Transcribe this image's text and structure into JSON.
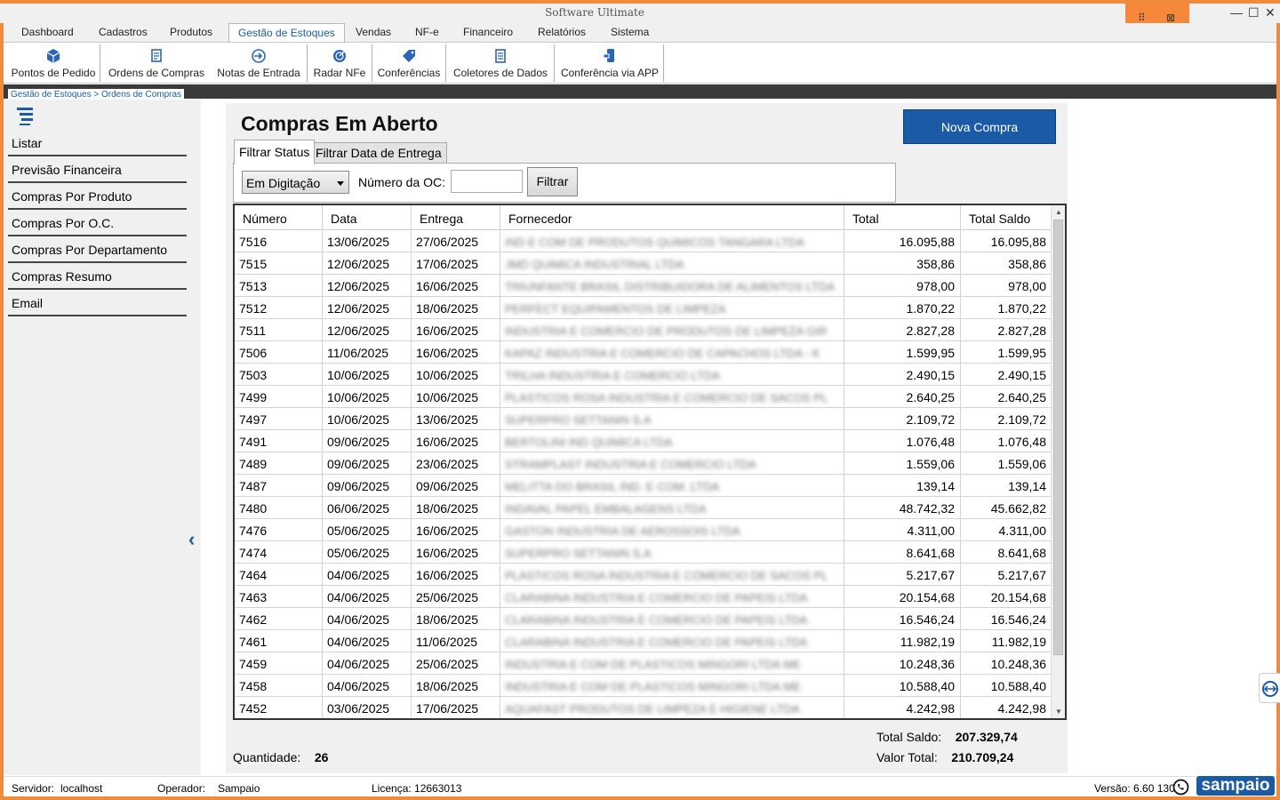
{
  "window": {
    "title": "Software Ultimate"
  },
  "menu": [
    "Dashboard",
    "Cadastros",
    "Produtos",
    "Gestão de Estoques",
    "Vendas",
    "NF-e",
    "Financeiro",
    "Relatórios",
    "Sistema"
  ],
  "toolbar": [
    "Pontos de Pedido",
    "Ordens de Compras",
    "Notas de Entrada",
    "Radar NFe",
    "Conferências",
    "Coletores de Dados",
    "Conferência via APP"
  ],
  "breadcrumb": "Gestão de Estoques > Ordens de Compras",
  "sidebar": [
    "Listar",
    "Previsão Financeira",
    "Compras Por Produto",
    "Compras Por O.C.",
    "Compras Por Departamento",
    "Compras Resumo",
    "Email"
  ],
  "page": {
    "title": "Compras Em Aberto",
    "new_button": "Nova Compra",
    "tabs": [
      "Filtrar Status",
      "Filtrar Data de Entrega"
    ],
    "status_select": "Em Digitação",
    "oc_label": "Número da OC:",
    "oc_value": "",
    "filter_button": "Filtrar"
  },
  "table": {
    "columns": [
      "Número",
      "Data",
      "Entrega",
      "Fornecedor",
      "Total",
      "Total Saldo"
    ],
    "rows": [
      [
        "7516",
        "13/06/2025",
        "27/06/2025",
        "IND E COM DE PRODUTOS QUIMICOS TANGARA LTDA",
        "16.095,88",
        "16.095,88"
      ],
      [
        "7515",
        "12/06/2025",
        "17/06/2025",
        "JMD QUIMICA INDUSTRIAL LTDA",
        "358,86",
        "358,86"
      ],
      [
        "7513",
        "12/06/2025",
        "16/06/2025",
        "TRIUNFANTE BRASIL DISTRIBUIDORA DE ALIMENTOS LTDA",
        "978,00",
        "978,00"
      ],
      [
        "7512",
        "12/06/2025",
        "18/06/2025",
        "PERFECT EQUIPAMENTOS DE LIMPEZA",
        "1.870,22",
        "1.870,22"
      ],
      [
        "7511",
        "12/06/2025",
        "16/06/2025",
        "INDUSTRIA E COMERCIO DE PRODUTOS DE LIMPEZA GIR",
        "2.827,28",
        "2.827,28"
      ],
      [
        "7506",
        "11/06/2025",
        "16/06/2025",
        "KAPAZ INDUSTRIA E COMERCIO DE CAPACHOS LTDA - K",
        "1.599,95",
        "1.599,95"
      ],
      [
        "7503",
        "10/06/2025",
        "10/06/2025",
        "TRILHA INDUSTRIA E COMERCIO LTDA",
        "2.490,15",
        "2.490,15"
      ],
      [
        "7499",
        "10/06/2025",
        "10/06/2025",
        "PLASTICOS ROSA INDUSTRIA E COMERCIO DE SACOS PL",
        "2.640,25",
        "2.640,25"
      ],
      [
        "7497",
        "10/06/2025",
        "13/06/2025",
        "SUPERPRO SETTANIN S.A",
        "2.109,72",
        "2.109,72"
      ],
      [
        "7491",
        "09/06/2025",
        "16/06/2025",
        "BERTOLINI IND QUIMICA LTDA",
        "1.076,48",
        "1.076,48"
      ],
      [
        "7489",
        "09/06/2025",
        "23/06/2025",
        "STRAMPLAST INDUSTRIA E COMERCIO LTDA",
        "1.559,06",
        "1.559,06"
      ],
      [
        "7487",
        "09/06/2025",
        "09/06/2025",
        "MELITTA DO BRASIL IND. E COM. LTDA",
        "139,14",
        "139,14"
      ],
      [
        "7480",
        "06/06/2025",
        "18/06/2025",
        "INDAVAL PAPEL EMBALAGENS LTDA",
        "48.742,32",
        "45.662,82"
      ],
      [
        "7476",
        "05/06/2025",
        "16/06/2025",
        "GASTON INDUSTRIA DE AEROSSOIS LTDA",
        "4.311,00",
        "4.311,00"
      ],
      [
        "7474",
        "05/06/2025",
        "16/06/2025",
        "SUPERPRO SETTANIN S.A",
        "8.641,68",
        "8.641,68"
      ],
      [
        "7464",
        "04/06/2025",
        "16/06/2025",
        "PLASTICOS ROSA INDUSTRIA E COMERCIO DE SACOS PL",
        "5.217,67",
        "5.217,67"
      ],
      [
        "7463",
        "04/06/2025",
        "25/06/2025",
        "CLARABINA INDUSTRIA E COMERCIO DE PAPEIS LTDA",
        "20.154,68",
        "20.154,68"
      ],
      [
        "7462",
        "04/06/2025",
        "18/06/2025",
        "CLARABINA INDUSTRIA E COMERCIO DE PAPEIS LTDA",
        "16.546,24",
        "16.546,24"
      ],
      [
        "7461",
        "04/06/2025",
        "11/06/2025",
        "CLARABINA INDUSTRIA E COMERCIO DE PAPEIS LTDA",
        "11.982,19",
        "11.982,19"
      ],
      [
        "7459",
        "04/06/2025",
        "25/06/2025",
        "INDUSTRIA E COM DE PLASTICOS MINGORI LTDA ME",
        "10.248,36",
        "10.248,36"
      ],
      [
        "7458",
        "04/06/2025",
        "18/06/2025",
        "INDUSTRIA E COM DE PLASTICOS MINGORI LTDA ME",
        "10.588,40",
        "10.588,40"
      ],
      [
        "7452",
        "03/06/2025",
        "17/06/2025",
        "AQUAFAST PRODUTOS DE LIMPEZA E HIGIENE LTDA",
        "4.242,98",
        "4.242,98"
      ]
    ]
  },
  "summary": {
    "qty_label": "Quantidade:",
    "qty_value": "26",
    "saldo_label": "Total Saldo:",
    "saldo_value": "207.329,74",
    "total_label": "Valor Total:",
    "total_value": "210.709,24"
  },
  "status": {
    "server_label": "Servidor:",
    "server_value": "localhost",
    "operator_label": "Operador:",
    "operator_value": "Sampaio",
    "license": "Licença: 12663013",
    "version": "Versão: 6.60 130",
    "brand": "sampaio"
  },
  "colors": {
    "frame": "#f08a3c",
    "accent": "#1b5aa5"
  }
}
